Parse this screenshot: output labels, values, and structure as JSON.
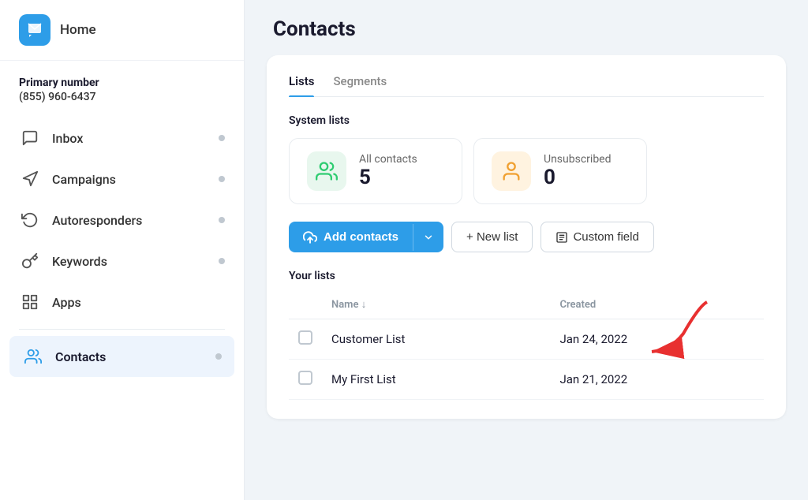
{
  "sidebar": {
    "logo_alt": "App logo",
    "home_label": "Home",
    "primary_number_label": "Primary number",
    "phone_number": "(855) 960-6437",
    "nav_items": [
      {
        "id": "inbox",
        "label": "Inbox",
        "icon": "chat-icon",
        "dot": true
      },
      {
        "id": "campaigns",
        "label": "Campaigns",
        "icon": "megaphone-icon",
        "dot": true
      },
      {
        "id": "autoresponders",
        "label": "Autoresponders",
        "icon": "refresh-icon",
        "dot": true
      },
      {
        "id": "keywords",
        "label": "Keywords",
        "icon": "key-icon",
        "dot": true
      },
      {
        "id": "apps",
        "label": "Apps",
        "icon": "apps-icon",
        "dot": false
      }
    ],
    "active_item": "contacts",
    "active_label": "Contacts",
    "active_icon": "contacts-icon",
    "active_dot": true
  },
  "main": {
    "title": "Contacts",
    "tabs": [
      {
        "id": "lists",
        "label": "Lists",
        "active": true
      },
      {
        "id": "segments",
        "label": "Segments",
        "active": false
      }
    ],
    "system_lists_title": "System lists",
    "system_lists": [
      {
        "id": "all-contacts",
        "name": "All contacts",
        "count": "5",
        "color": "green"
      },
      {
        "id": "unsubscribed",
        "name": "Unsubscribed",
        "count": "0",
        "color": "orange"
      }
    ],
    "buttons": {
      "add_contacts": "Add contacts",
      "new_list": "+ New list",
      "custom_field": "Custom field"
    },
    "your_lists_title": "Your lists",
    "table": {
      "columns": [
        {
          "id": "checkbox",
          "label": ""
        },
        {
          "id": "name",
          "label": "Name ↓"
        },
        {
          "id": "created",
          "label": "Created"
        }
      ],
      "rows": [
        {
          "id": "row1",
          "name": "Customer List",
          "created": "Jan 24, 2022",
          "has_arrow": true
        },
        {
          "id": "row2",
          "name": "My First List",
          "created": "Jan 21, 2022",
          "has_arrow": false
        }
      ]
    }
  }
}
